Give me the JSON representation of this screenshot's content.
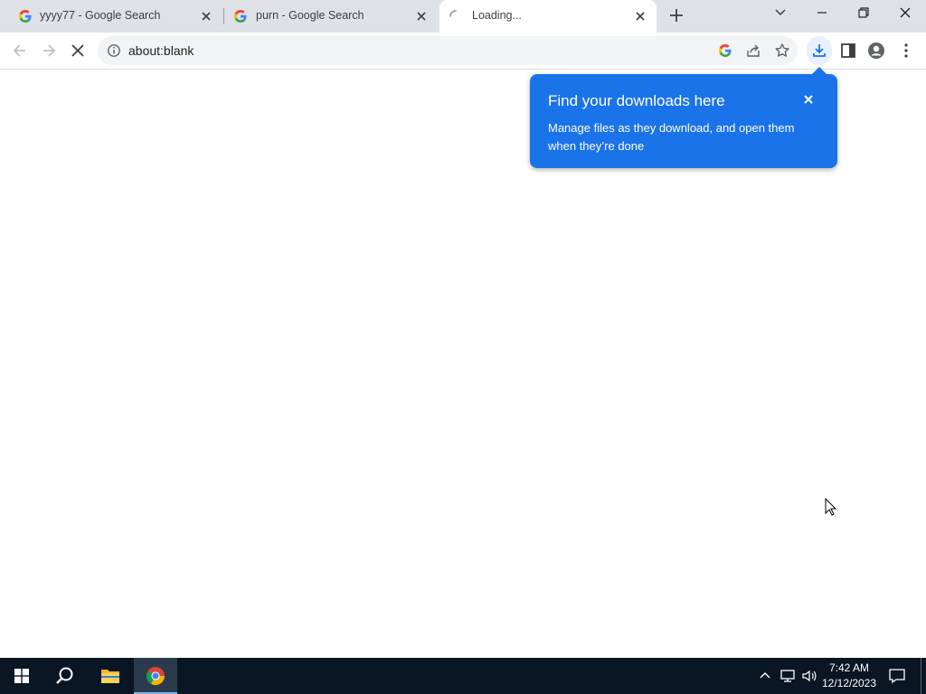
{
  "browser": {
    "tabs": [
      {
        "title": "yyyy77 - Google Search",
        "favicon": "google-g-icon"
      },
      {
        "title": "purn - Google Search",
        "favicon": "google-g-icon"
      },
      {
        "title": "Loading...",
        "favicon": "loading-spinner-icon",
        "active": true
      }
    ],
    "address_bar": {
      "url": "about:blank"
    }
  },
  "downloads_bubble": {
    "title": "Find your downloads here",
    "body": "Manage files as they download, and open them when they’re done"
  },
  "taskbar": {
    "clock": {
      "time": "7:42 AM",
      "date": "12/12/2023"
    }
  },
  "colors": {
    "accent": "#1a73e8",
    "tabstrip": "#dee1e6",
    "taskbar": "#0b1624"
  }
}
